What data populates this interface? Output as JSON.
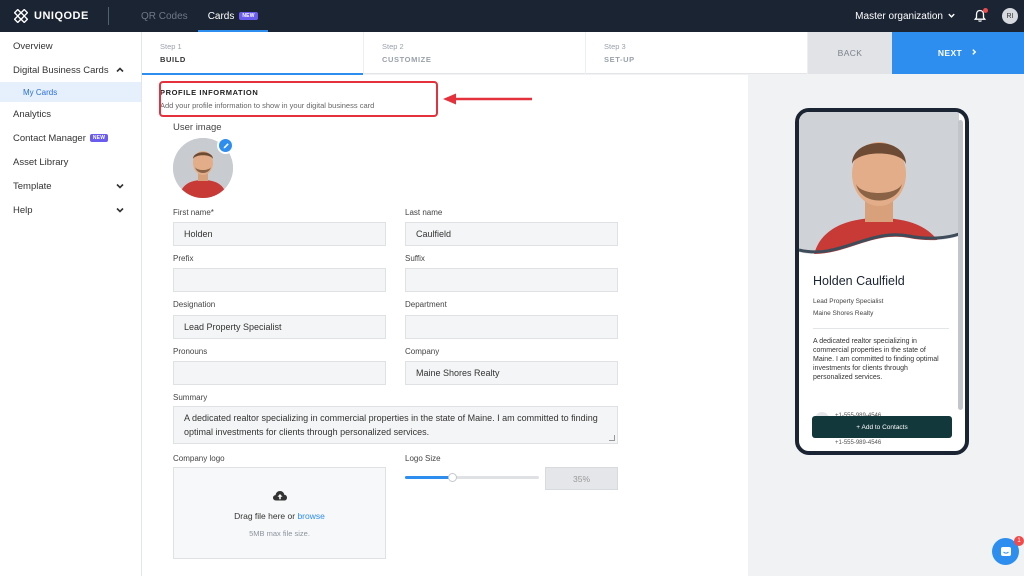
{
  "topbar": {
    "brand": "UNIQODE",
    "tabs": [
      {
        "label": "QR Codes",
        "active": false
      },
      {
        "label": "Cards",
        "active": true,
        "badge": "NEW"
      }
    ],
    "organization": "Master organization",
    "user_initials": "RI"
  },
  "sidebar": {
    "items": [
      {
        "label": "Overview"
      },
      {
        "label": "Digital Business Cards",
        "expanded": true
      },
      {
        "label": "My Cards",
        "selected": true
      },
      {
        "label": "Analytics"
      },
      {
        "label": "Contact Manager",
        "badge": "NEW"
      },
      {
        "label": "Asset Library"
      },
      {
        "label": "Template"
      },
      {
        "label": "Help"
      }
    ]
  },
  "stepper": {
    "steps": [
      {
        "num": "Step 1",
        "name": "BUILD",
        "active": true
      },
      {
        "num": "Step 2",
        "name": "CUSTOMIZE",
        "active": false
      },
      {
        "num": "Step 3",
        "name": "SET-UP",
        "active": false
      }
    ],
    "back_label": "BACK",
    "next_label": "NEXT"
  },
  "form": {
    "section_title": "PROFILE INFORMATION",
    "section_subtitle": "Add your profile information to show in your digital business card",
    "user_image_label": "User image",
    "first_name": {
      "label": "First name*",
      "value": "Holden"
    },
    "last_name": {
      "label": "Last name",
      "value": "Caulfield"
    },
    "prefix": {
      "label": "Prefix",
      "value": ""
    },
    "suffix": {
      "label": "Suffix",
      "value": ""
    },
    "designation": {
      "label": "Designation",
      "value": "Lead Property Specialist"
    },
    "department": {
      "label": "Department",
      "value": ""
    },
    "pronouns": {
      "label": "Pronouns",
      "value": ""
    },
    "company": {
      "label": "Company",
      "value": "Maine Shores Realty"
    },
    "summary": {
      "label": "Summary",
      "value": "A dedicated realtor specializing in commercial properties in the state of Maine. I am committed to finding optimal investments for clients through personalized services."
    },
    "company_logo": {
      "label": "Company logo",
      "drop_text": "Drag file here or",
      "browse_link": "browse",
      "hint": "5MB max file size."
    },
    "logo_size": {
      "label": "Logo Size",
      "value_text": "35%",
      "value": 0.35
    }
  },
  "preview": {
    "name": "Holden Caulfield",
    "title": "Lead Property Specialist",
    "company": "Maine Shores Realty",
    "summary": "A dedicated realtor specializing in commercial properties in the state of Maine. I am committed to finding optimal investments for clients through personalized services.",
    "phone_1": "+1-555-989-4546",
    "phone_2": "+1-555-989-4546",
    "add_contacts_label": "+ Add to Contacts"
  },
  "chat": {
    "badge_count": "1"
  },
  "colors": {
    "accent": "#2e8ef0",
    "topbar": "#1b2432",
    "highlight": "#e5313b",
    "preview_button": "#12383b",
    "new_badge": "#6b5cf0"
  }
}
